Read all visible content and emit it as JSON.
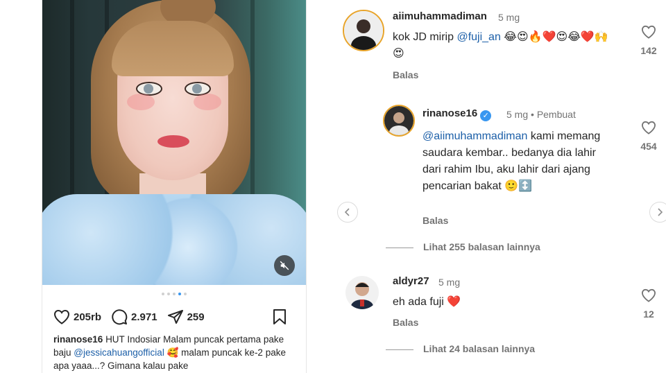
{
  "post": {
    "carousel_pages": 5,
    "active_page": 4,
    "actions": {
      "likes": "205rb",
      "comments": "2.971",
      "shares": "259"
    },
    "caption": {
      "username": "rinanose16",
      "text_1": "HUT Indosiar Malam puncak pertama pake baju ",
      "mention": "@jessicahuangofficial",
      "emoji": "🥰",
      "text_2": " malam puncak ke-2 pake apa yaaa...? Gimana kalau pake"
    }
  },
  "comments": [
    {
      "username": "aiimuhammadiman",
      "time": "5 mg",
      "text_prefix": "kok JD mirip ",
      "mention": "@fuji_an",
      "emojis": "😂😍🔥❤️😍😂❤️🙌😍",
      "reply_label": "Balas",
      "like_count": "142"
    },
    {
      "username": "rinanose16",
      "time": "5 mg",
      "author_label": "Pembuat",
      "mention": "@aiimuhammadiman",
      "text": " kami memang saudara kembar.. bedanya dia lahir dari rahim Ibu, aku lahir dari ajang pencarian bakat 🙂↕️",
      "reply_label": "Balas",
      "like_count": "454"
    },
    {
      "more_replies": "Lihat 255 balasan lainnya"
    },
    {
      "username": "aldyr27",
      "time": "5 mg",
      "text": "eh ada fuji ❤️",
      "reply_label": "Balas",
      "like_count": "12"
    },
    {
      "more_replies": "Lihat 24 balasan lainnya"
    }
  ],
  "colors": {
    "mention": "#1c5fa8",
    "verified": "#3897f0",
    "muted_text": "#737373",
    "story_ring": "#e8a42a"
  }
}
